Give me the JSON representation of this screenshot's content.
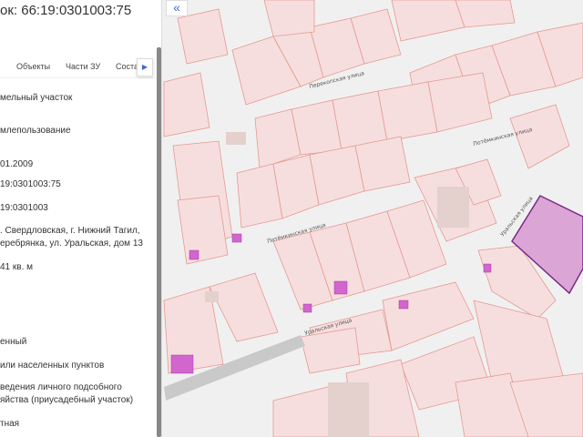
{
  "panel": {
    "title": "ок: 66:19:0301003:75",
    "tabs": [
      "Объекты",
      "Части ЗУ",
      "Соста"
    ],
    "tab_next_icon": "chevron-right-icon",
    "rows": [
      "мельный участок",
      "млепользование",
      "01.2009",
      "19:0301003:75",
      "19:0301003",
      ". Свердловская, г. Нижний Тагил,",
      "еребрянка, ул. Уральская, дом 13",
      "41 кв. м",
      "енный",
      "или населенных пунктов",
      " ведения личного подсобного",
      "яйства (приусадебный участок)",
      "тная"
    ]
  },
  "map": {
    "collapse_icon": "double-chevron-left-icon",
    "collapse_label": "«",
    "streets": [
      "Перекопская улица",
      "Потёмкинская улица",
      "Потёмкинская улица",
      "Уральская улица",
      "Уральская улица"
    ],
    "parcel_fill": "#f7dede",
    "parcel_stroke": "#e39a92",
    "selected_fill": "#dba6d6",
    "selected_stroke": "#7a2a86"
  }
}
